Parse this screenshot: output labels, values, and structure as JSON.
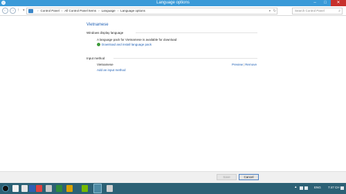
{
  "window": {
    "title": "Language options",
    "min_glyph": "–",
    "max_glyph": "□",
    "close_glyph": "✕"
  },
  "nav": {
    "back_glyph": "←",
    "forward_glyph": "→",
    "up_glyph": "↑",
    "recent_glyph": "▾",
    "breadcrumb": [
      "Control Panel",
      "All Control Panel Items",
      "Language",
      "Language options"
    ],
    "breadcrumb_sep": "›",
    "dropdown_glyph": "▾",
    "refresh_glyph": "↻",
    "search_placeholder": "Search Control Panel",
    "search_glyph": "⌕"
  },
  "content": {
    "language": "Vietnamese",
    "display_section": {
      "title": "Windows display language",
      "info": "A language pack for Vietnamese is available for download",
      "download_link": "Download and install language pack"
    },
    "input_section": {
      "title": "Input method",
      "method_name": "Vietnamese",
      "preview_link": "Preview",
      "separator": "|",
      "remove_link": "Remove",
      "add_link": "Add an input method"
    }
  },
  "footer": {
    "save_label": "Save",
    "cancel_label": "Cancel"
  },
  "taskbar": {
    "tray_caret": "▴",
    "language": "ENG",
    "time": "7:47 CH"
  },
  "colors": {
    "titlebar": "#3a9ad8",
    "link": "#1e5fb4",
    "taskbar": "#2c6175",
    "close": "#c7312c"
  }
}
